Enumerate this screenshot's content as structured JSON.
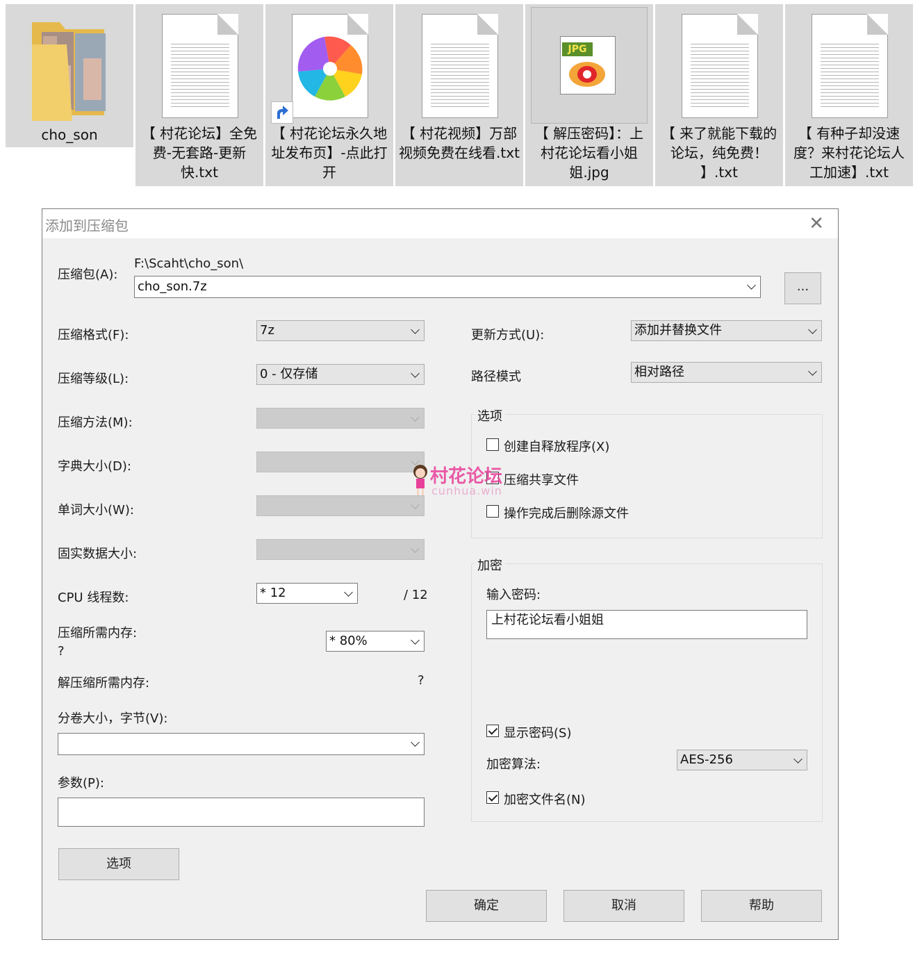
{
  "files": [
    {
      "name": "cho_son",
      "type": "folder"
    },
    {
      "name": "【 村花论坛】全免费-无套路-更新快.txt",
      "type": "txt"
    },
    {
      "name": "【 村花论坛永久地址发布页】-点此打开",
      "type": "shortcut"
    },
    {
      "name": "【 村花视频】万部视频免费在线看.txt",
      "type": "txt"
    },
    {
      "name": "【 解压密码】：上村花论坛看小姐姐.jpg",
      "type": "jpg",
      "badge": "JPG"
    },
    {
      "name": "【 来了就能下载的论坛，纯免费！ 】.txt",
      "type": "txt"
    },
    {
      "name": "【 有种子却没速度？来村花论坛人工加速】.txt",
      "type": "txt"
    }
  ],
  "dialog": {
    "title": "添加到压缩包",
    "archive_label": "压缩包(A):",
    "archive_path": "F:\\Scaht\\cho_son\\",
    "archive_name": "cho_son.7z",
    "browse_label": "...",
    "format_label": "压缩格式(F):",
    "format_value": "7z",
    "level_label": "压缩等级(L):",
    "level_value": "0 - 仅存储",
    "method_label": "压缩方法(M):",
    "dict_label": "字典大小(D):",
    "word_label": "单词大小(W):",
    "solid_label": "固实数据大小:",
    "cpu_label": "CPU 线程数:",
    "cpu_value": "* 12",
    "cpu_total": "/ 12",
    "mem_label": "压缩所需内存:",
    "mem_unknown": "?",
    "mem_value": "* 80%",
    "decomp_label": "解压缩所需内存:",
    "decomp_value": "?",
    "volume_label": "分卷大小，字节(V):",
    "volume_value": "",
    "params_label": "参数(P):",
    "params_value": "",
    "options_button": "选项",
    "update_label": "更新方式(U):",
    "update_value": "添加并替换文件",
    "path_label": "路径模式",
    "path_value": "相对路径",
    "options_group": "选项",
    "opt_sfx": "创建自释放程序(X)",
    "opt_shared": "压缩共享文件",
    "opt_delete": "操作完成后删除源文件",
    "enc_group": "加密",
    "pwd_label": "输入密码:",
    "pwd_value": "上村花论坛看小姐姐",
    "show_pwd": "显示密码(S)",
    "algo_label": "加密算法:",
    "algo_value": "AES-256",
    "enc_names": "加密文件名(N)",
    "ok": "确定",
    "cancel": "取消",
    "help": "帮助"
  },
  "watermark": {
    "title": "村花论坛",
    "sub": "cunhua.win",
    "color": "#e8409a"
  },
  "checks": {
    "sfx": false,
    "shared": false,
    "delete": false,
    "show_pwd": true,
    "enc_names": true
  }
}
